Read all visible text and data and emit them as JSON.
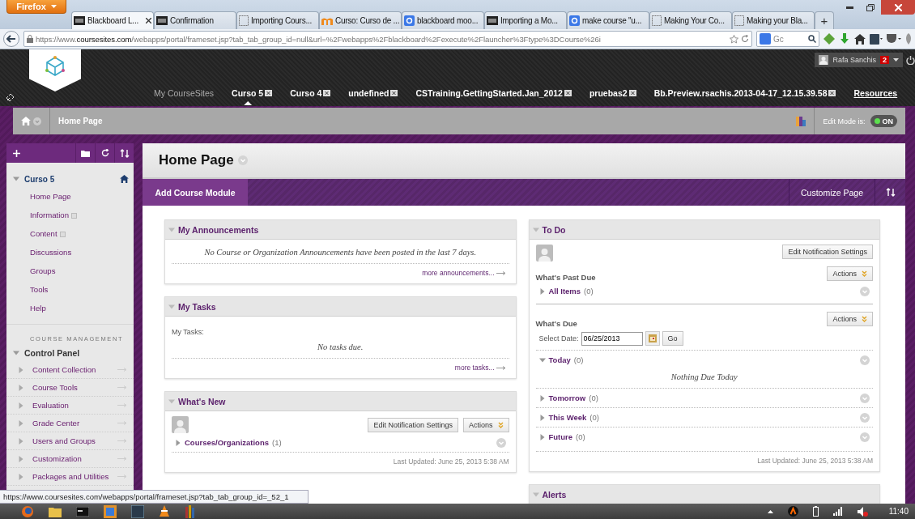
{
  "browser": {
    "menu_label": "Firefox",
    "tabs": [
      {
        "label": "Blackboard L...",
        "selected": true,
        "kind": "blackboard"
      },
      {
        "label": "Confirmation",
        "selected": false,
        "kind": "blackboard"
      },
      {
        "label": "Importing Cours...",
        "selected": false,
        "kind": "blank"
      },
      {
        "label": "Curso: Curso de ...",
        "selected": false,
        "kind": "moodle"
      },
      {
        "label": "blackboard moo...",
        "selected": false,
        "kind": "google"
      },
      {
        "label": "Importing a Mo...",
        "selected": false,
        "kind": "blackboard"
      },
      {
        "label": "make course \"u...",
        "selected": false,
        "kind": "google"
      },
      {
        "label": "Making Your Co...",
        "selected": false,
        "kind": "blank"
      },
      {
        "label": "Making your Bla...",
        "selected": false,
        "kind": "blank"
      }
    ],
    "new_tab": "+",
    "url_scheme": "https://www.",
    "url_domain": "coursesites.com",
    "url_path": "/webapps/portal/frameset.jsp?tab_tab_group_id=null&url=%2Fwebapps%2Fblackboard%2Fexecute%2Flauncher%3Ftype%3DCourse%26i",
    "search_placeholder": "Gc"
  },
  "header": {
    "user": "Rafa Sanchis",
    "notifications": "2",
    "nav": [
      {
        "label": "My CourseSites",
        "selected": false,
        "closable": false,
        "kind": "home"
      },
      {
        "label": "Curso 5",
        "selected": true,
        "closable": true,
        "kind": "course"
      },
      {
        "label": "Curso 4",
        "selected": false,
        "closable": true,
        "kind": "course"
      },
      {
        "label": "undefined",
        "selected": false,
        "closable": true,
        "kind": "course"
      },
      {
        "label": "CSTraining.GettingStarted.Jan_2012",
        "selected": false,
        "closable": true,
        "kind": "course"
      },
      {
        "label": "pruebas2",
        "selected": false,
        "closable": true,
        "kind": "course"
      },
      {
        "label": "Bb.Preview.rsachis.2013-04-17_12.15.39.58",
        "selected": false,
        "closable": true,
        "kind": "course"
      },
      {
        "label": "Resources",
        "selected": false,
        "closable": false,
        "kind": "link"
      }
    ]
  },
  "breadcrumb": {
    "page": "Home Page",
    "edit_mode_label": "Edit Mode is:",
    "edit_mode": {
      "label": "ON",
      "on": true
    }
  },
  "sidebar": {
    "course": {
      "label": "Curso 5",
      "expanded": true
    },
    "items": [
      {
        "label": "Home Page",
        "marked": false
      },
      {
        "label": "Information",
        "marked": true
      },
      {
        "label": "Content",
        "marked": true
      },
      {
        "label": "Discussions",
        "marked": false
      },
      {
        "label": "Groups",
        "marked": false
      },
      {
        "label": "Tools",
        "marked": false
      },
      {
        "label": "Help",
        "marked": false
      }
    ],
    "section_title": "COURSE MANAGEMENT",
    "panel": {
      "label": "Control Panel",
      "expanded": true
    },
    "panel_items": [
      {
        "label": "Content Collection",
        "expanded": false
      },
      {
        "label": "Course Tools",
        "expanded": false
      },
      {
        "label": "Evaluation",
        "expanded": false
      },
      {
        "label": "Grade Center",
        "expanded": false
      },
      {
        "label": "Users and Groups",
        "expanded": false
      },
      {
        "label": "Customization",
        "expanded": false
      },
      {
        "label": "Packages and Utilities",
        "expanded": false
      }
    ]
  },
  "page": {
    "title": "Home Page",
    "add_module": "Add Course Module",
    "customize": "Customize Page"
  },
  "announcements": {
    "title": "My Announcements",
    "message": "No Course or Organization Announcements have been posted in the last 7 days.",
    "more": "more announcements..."
  },
  "tasks": {
    "title": "My Tasks",
    "label": "My Tasks:",
    "message": "No tasks due.",
    "more": "more tasks..."
  },
  "whats_new": {
    "title": "What's New",
    "notify_button": "Edit Notification Settings",
    "actions_button": "Actions",
    "groups": [
      {
        "label": "Courses/Organizations",
        "count": "(1)",
        "expanded": false
      }
    ],
    "updated": "Last Updated: June 25, 2013 5:38 AM"
  },
  "todo": {
    "title": "To Do",
    "notify_button": "Edit Notification Settings",
    "past_due": {
      "title": "What's Past Due",
      "actions_button": "Actions",
      "groups": [
        {
          "label": "All Items",
          "count": "(0)",
          "expanded": false
        }
      ]
    },
    "due": {
      "title": "What's Due",
      "actions_button": "Actions",
      "date_label": "Select Date:",
      "date": "06/25/2013",
      "go": "Go",
      "groups": [
        {
          "label": "Today",
          "count": "(0)",
          "expanded": true,
          "message": "Nothing Due Today"
        },
        {
          "label": "Tomorrow",
          "count": "(0)",
          "expanded": false
        },
        {
          "label": "This Week",
          "count": "(0)",
          "expanded": false
        },
        {
          "label": "Future",
          "count": "(0)",
          "expanded": false
        }
      ]
    },
    "updated": "Last Updated: June 25, 2013 5:38 AM"
  },
  "alerts": {
    "title": "Alerts"
  },
  "status_url": "https://www.coursesites.com/webapps/portal/frameset.jsp?tab_tab_group_id=_52_1",
  "taskbar": {
    "time": "11:40"
  }
}
